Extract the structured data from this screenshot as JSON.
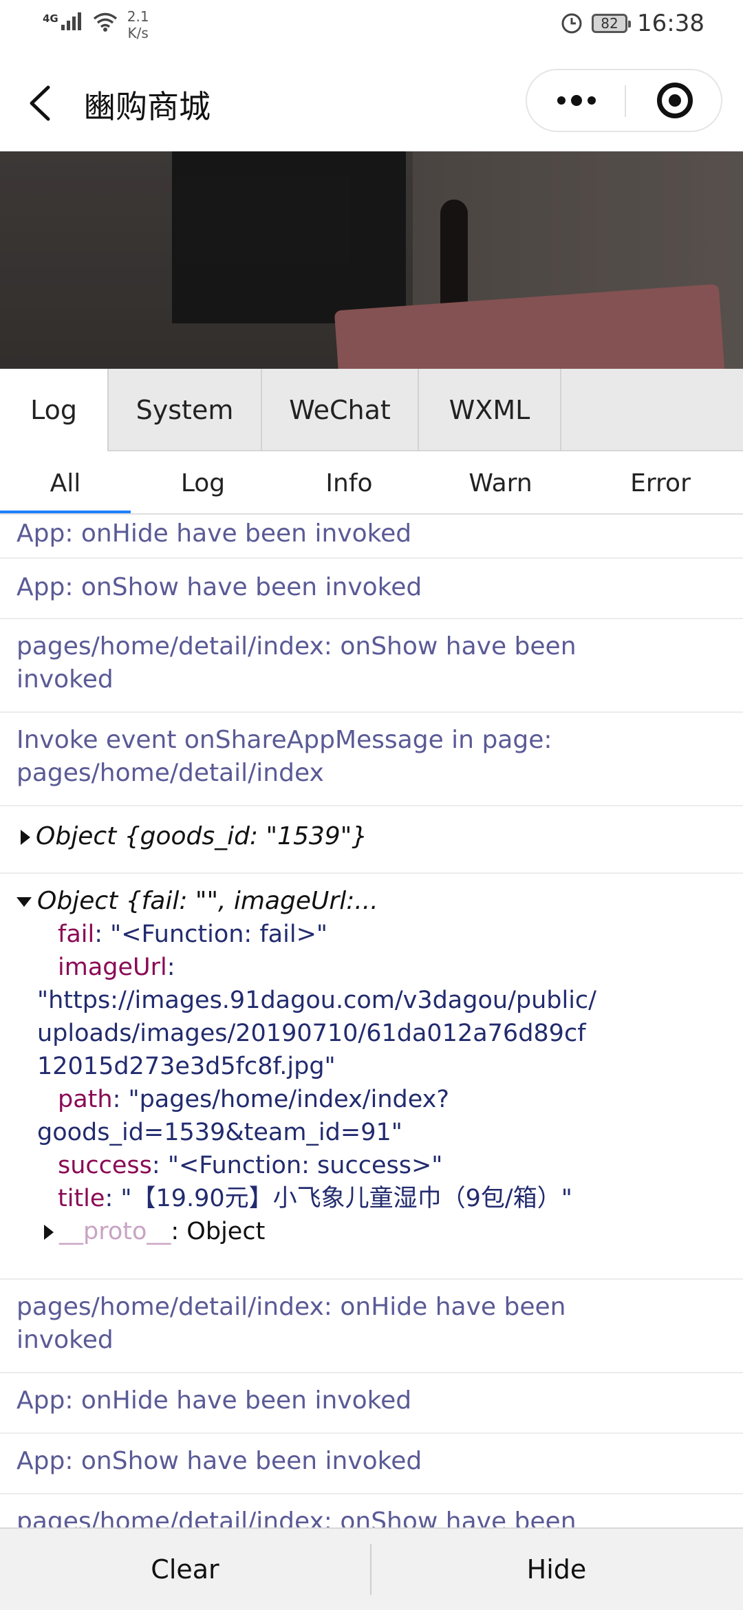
{
  "status_bar": {
    "network": "4G",
    "speed_value": "2.1",
    "speed_unit": "K/s",
    "battery": "82",
    "time": "16:38"
  },
  "nav": {
    "title": "豳购商城"
  },
  "vconsole_tabs": [
    "Log",
    "System",
    "WeChat",
    "WXML"
  ],
  "filters": [
    "All",
    "Log",
    "Info",
    "Warn",
    "Error"
  ],
  "logs": {
    "l1": "App: onHide have been invoked",
    "l2": "App: onShow have been invoked",
    "l3a": "pages/home/detail/index: onShow have been",
    "l3b": "invoked",
    "l4a": "Invoke event onShareAppMessage in page:",
    "l4b": "pages/home/detail/index",
    "l5": "Object {goods_id: \"1539\"}",
    "l6_head": "Object {fail: \"\", imageUrl:...",
    "l6_fail_key": "fail",
    "l6_fail_val": ": \"<Function: fail>\"",
    "l6_img_key": "imageUrl",
    "l6_img_colon": ":",
    "l6_img_v1": "\"https://images.91dagou.com/v3dagou/public/",
    "l6_img_v2": "uploads/images/20190710/61da012a76d89cf",
    "l6_img_v3": "12015d273e3d5fc8f.jpg\"",
    "l6_path_key": "path",
    "l6_path_v1": ": \"pages/home/index/index?",
    "l6_path_v2": "goods_id=1539&team_id=91\"",
    "l6_succ_key": "success",
    "l6_succ_val": ": \"<Function: success>\"",
    "l6_title_key": "title",
    "l6_title_val": ": \"【19.90元】小飞象儿童湿巾（9包/箱）\"",
    "l6_proto_key": "__proto__",
    "l6_proto_val": ": Object",
    "l7a": "pages/home/detail/index: onHide have been",
    "l7b": "invoked",
    "l8": "App: onHide have been invoked",
    "l9": "App: onShow have been invoked",
    "l10": "pages/home/detail/index: onShow have been"
  },
  "bottom": {
    "clear": "Clear",
    "hide": "Hide"
  }
}
